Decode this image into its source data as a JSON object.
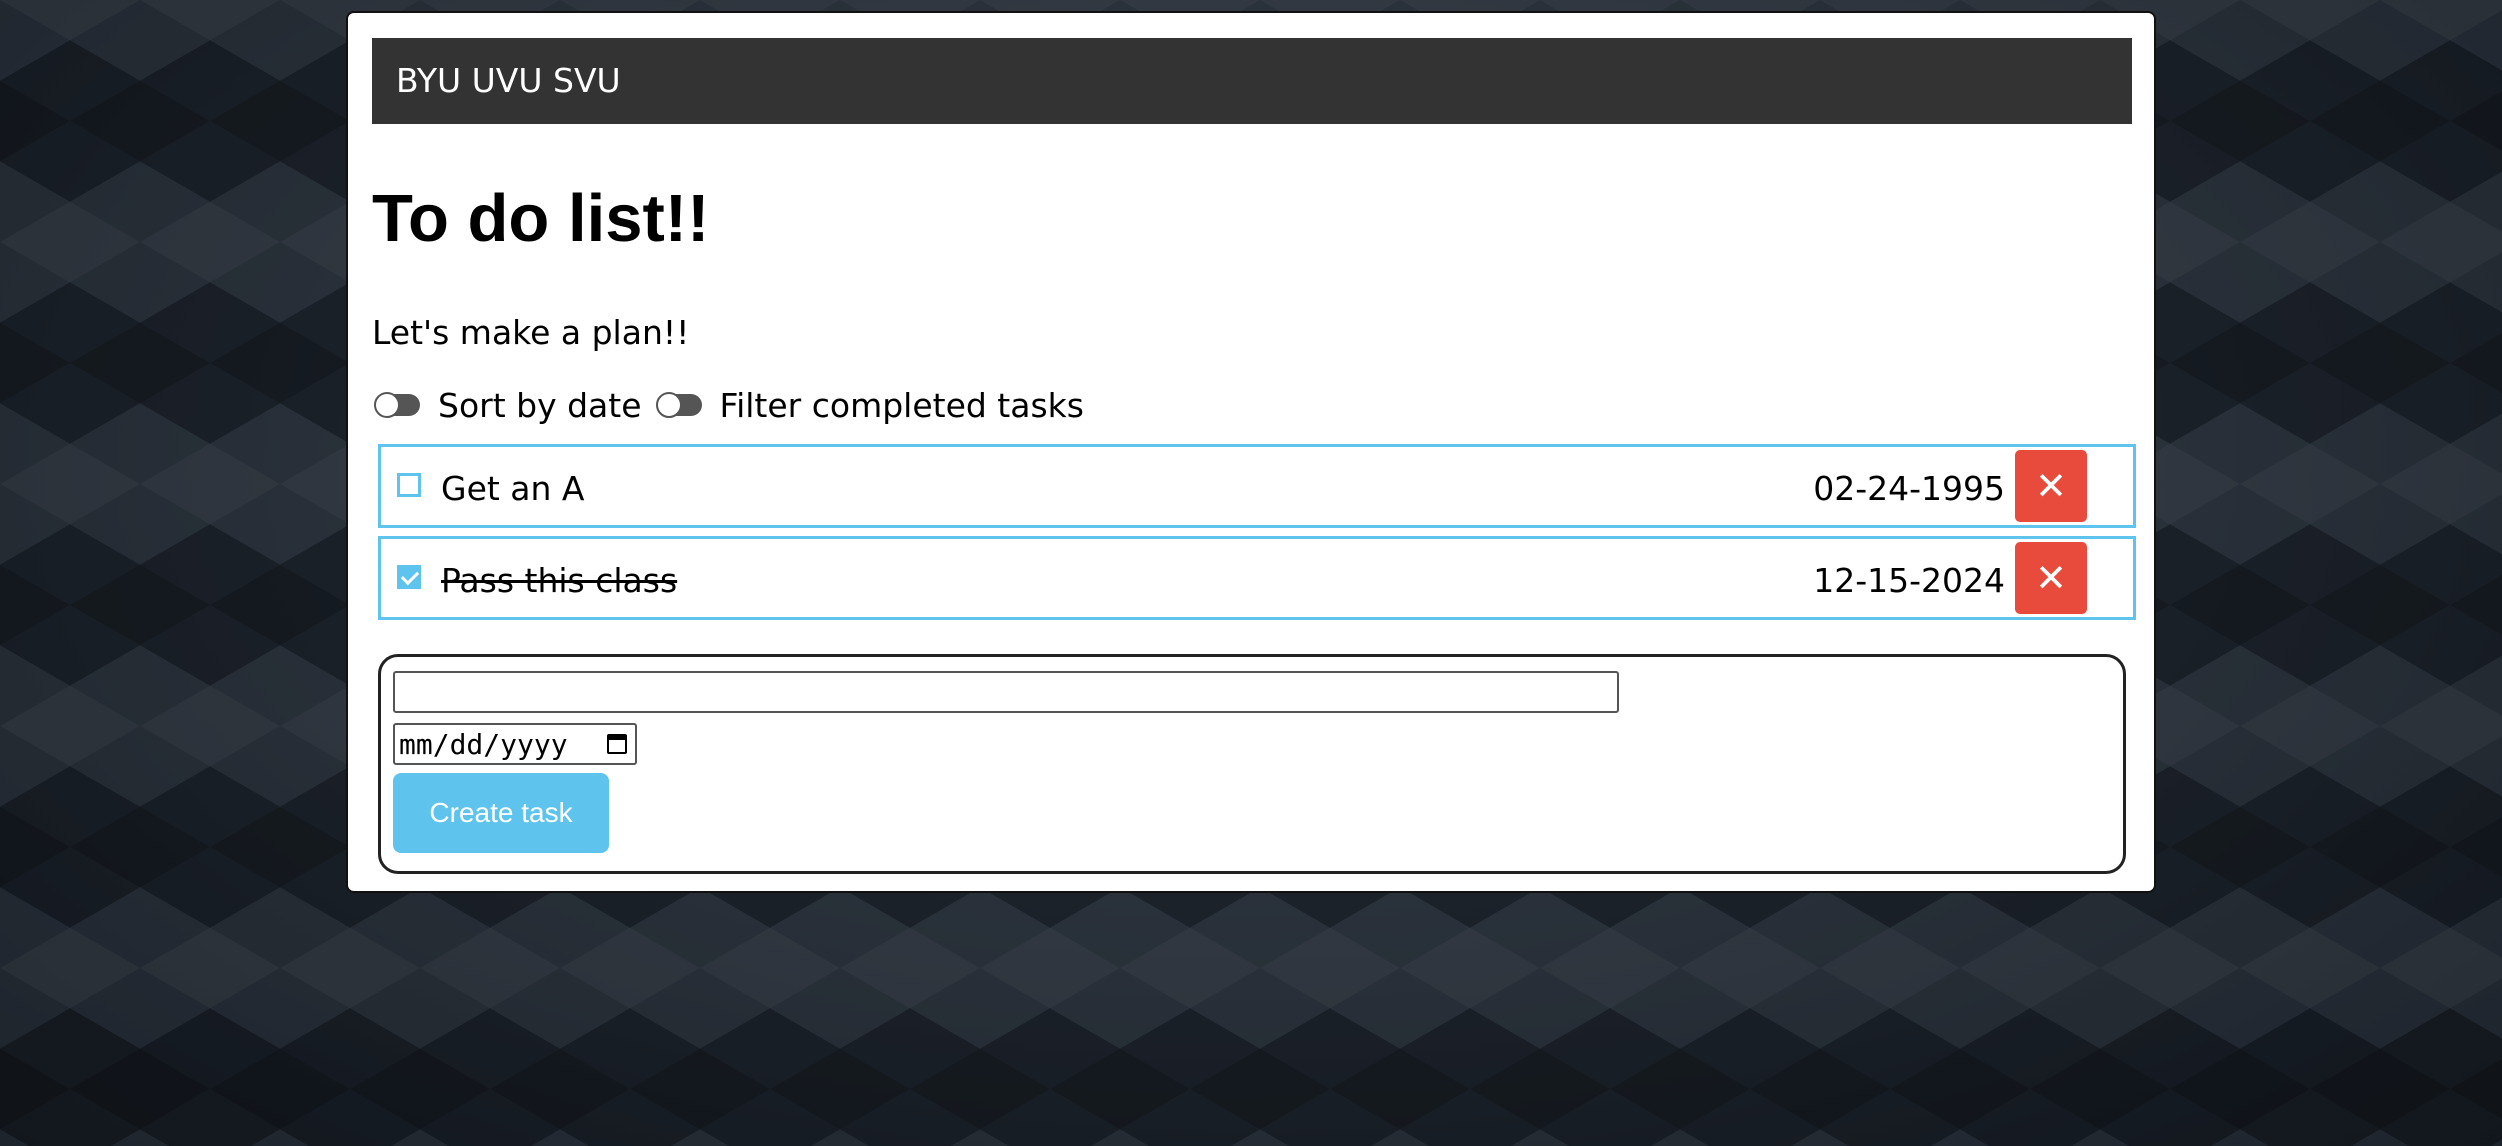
{
  "navbar": {
    "brand": "BYU UVU SVU"
  },
  "header": {
    "title": "To do list!!",
    "subtitle": "Let's make a plan!!"
  },
  "controls": {
    "sort_label": "Sort by date",
    "sort_enabled": false,
    "filter_label": "Filter completed tasks",
    "filter_enabled": false
  },
  "tasks": [
    {
      "name": "Get an A",
      "date": "02-24-1995",
      "completed": false,
      "delete_label": "✕"
    },
    {
      "name": "Pass this class",
      "date": "12-15-2024",
      "completed": true,
      "delete_label": "✕"
    }
  ],
  "form": {
    "task_input_value": "",
    "date_placeholder": "mm/dd/yyyy",
    "create_label": "Create task"
  },
  "colors": {
    "navbar_bg": "#333333",
    "accent": "#5ec4ee",
    "danger": "#e84a3c"
  }
}
